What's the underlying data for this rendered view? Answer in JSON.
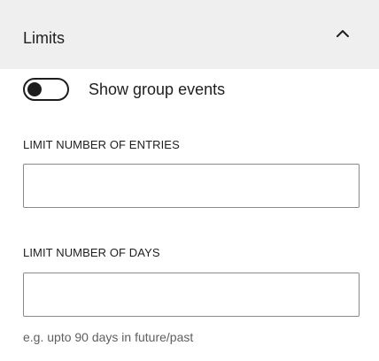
{
  "section": {
    "title": "Limits",
    "expanded": true
  },
  "toggle": {
    "label": "Show group events",
    "checked": false
  },
  "limit_entries": {
    "label": "LIMIT NUMBER OF ENTRIES",
    "value": ""
  },
  "limit_days": {
    "label": "LIMIT NUMBER OF DAYS",
    "value": "",
    "hint": "e.g. upto 90 days in future/past"
  },
  "colors": {
    "header_background": "#efefef",
    "text": "#1e1e1e",
    "hint_text": "#5f5f5f",
    "input_border": "#8a8a8a"
  },
  "icons": {
    "collapse": "chevron-up-icon"
  }
}
